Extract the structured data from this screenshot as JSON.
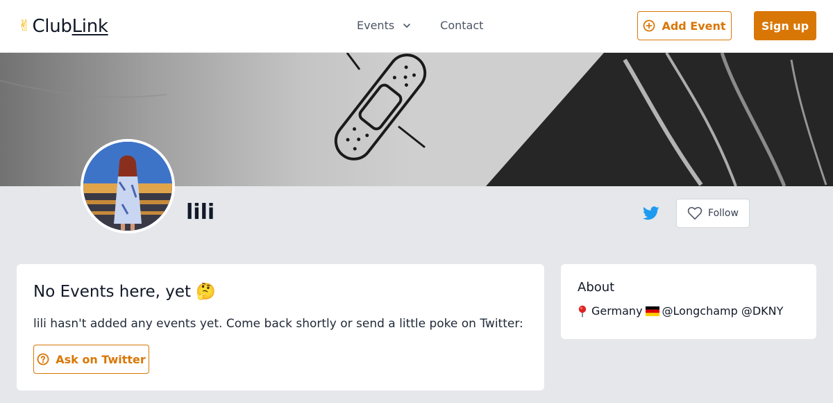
{
  "header": {
    "logo": {
      "emoji": "✌",
      "club": "Club",
      "link": "Link"
    },
    "nav": [
      {
        "label": "Events",
        "has_dropdown": true
      },
      {
        "label": "Contact"
      }
    ],
    "add_event_label": "Add Event",
    "signup_label": "Sign up"
  },
  "profile": {
    "name": "lili",
    "follow_label": "Follow",
    "social_icon": "twitter-icon"
  },
  "events_card": {
    "title": "No Events here, yet 🤔",
    "message": "lili hasn't added any events yet. Come back shortly or send a little poke on Twitter:",
    "ask_label": "Ask on Twitter"
  },
  "about_card": {
    "title": "About",
    "location": "Germany",
    "flag_icon": "germany-flag-icon",
    "handles": "@Longchamp @DKNY"
  },
  "colors": {
    "accent": "#d97706",
    "background": "#e5e7eb",
    "twitter": "#1d9bf0"
  }
}
